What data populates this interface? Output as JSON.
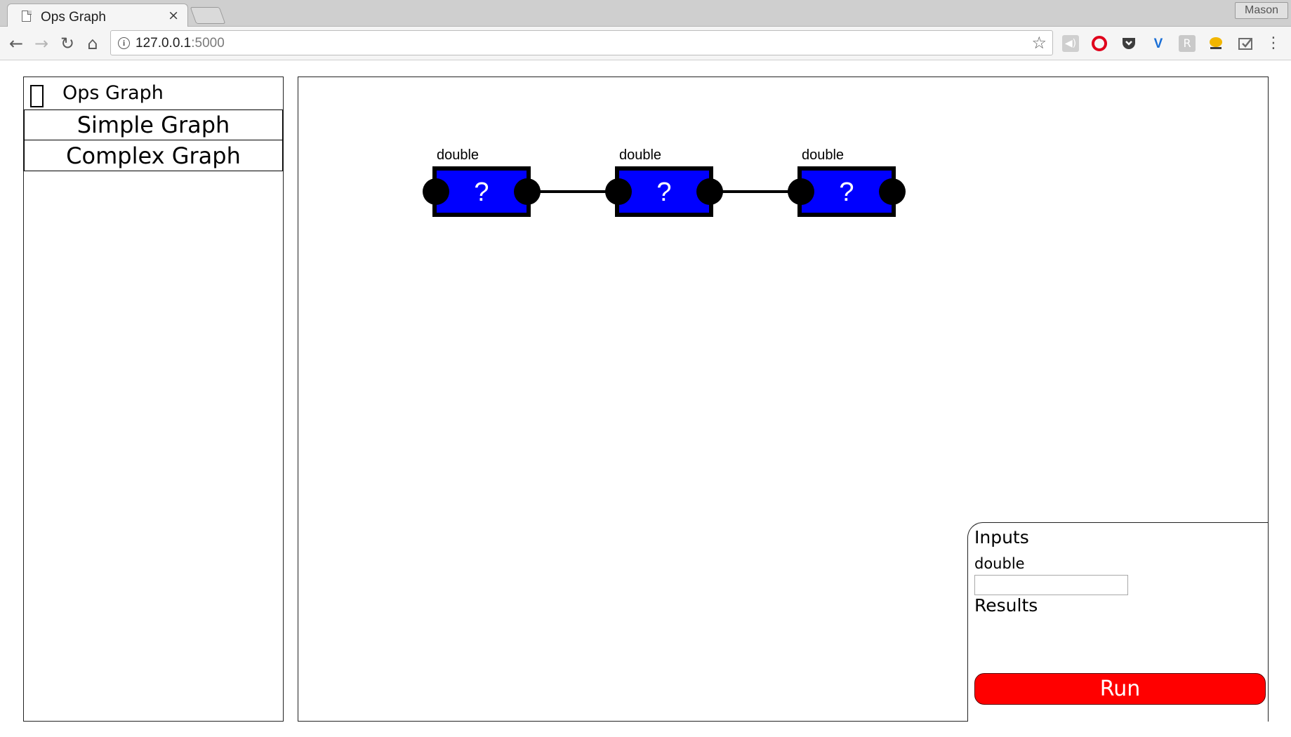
{
  "browser": {
    "tab_title": "Ops Graph",
    "tab_close": "×",
    "profile_name": "Mason",
    "url_host": "127.0.0.1",
    "url_port": ":5000",
    "nav": {
      "back": "←",
      "forward": "→",
      "reload": "↻",
      "home": "⌂"
    },
    "star": "☆",
    "menu": "⋮",
    "extensions": [
      "speaker-icon",
      "opera-icon",
      "pocket-icon",
      "vimeo-icon",
      "bookmark-icon",
      "chat-icon",
      "pocket-save-icon"
    ]
  },
  "sidebar": {
    "title": "Ops Graph",
    "items": [
      {
        "label": "Simple Graph"
      },
      {
        "label": "Complex Graph"
      }
    ]
  },
  "graph": {
    "node_color": "#0000ff",
    "nodes": [
      {
        "label": "double",
        "value": "?"
      },
      {
        "label": "double",
        "value": "?"
      },
      {
        "label": "double",
        "value": "?"
      }
    ]
  },
  "io_panel": {
    "inputs_heading": "Inputs",
    "input_label": "double",
    "input_value": "",
    "results_heading": "Results",
    "run_label": "Run",
    "run_color": "#ff0000"
  }
}
